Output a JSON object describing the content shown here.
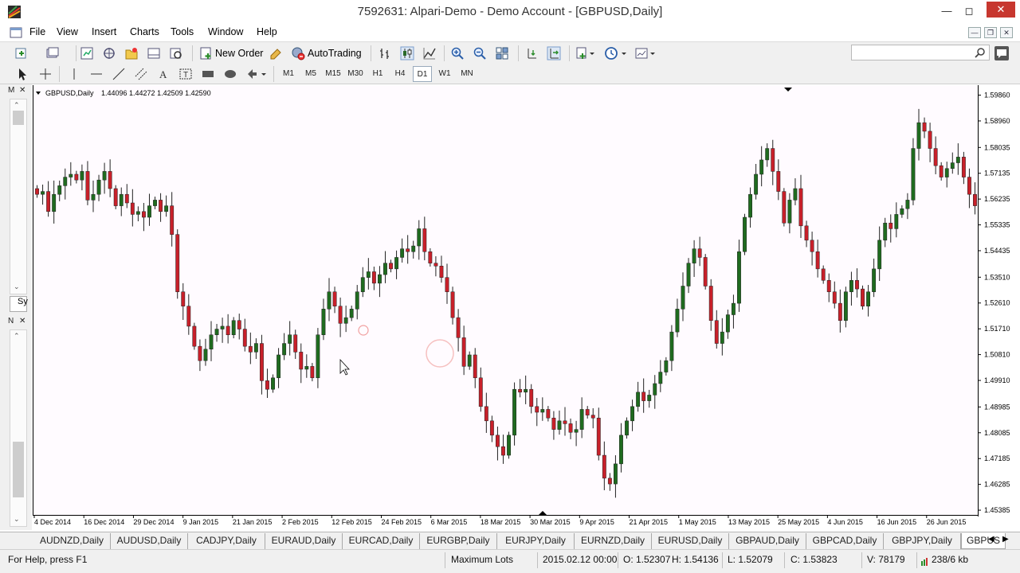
{
  "window": {
    "title": "7592631: Alpari-Demo - Demo Account - [GBPUSD,Daily]"
  },
  "menu": [
    "File",
    "View",
    "Insert",
    "Charts",
    "Tools",
    "Window",
    "Help"
  ],
  "toolbar": {
    "new_order": "New Order",
    "autotrading": "AutoTrading"
  },
  "timeframes": [
    "M1",
    "M5",
    "M15",
    "M30",
    "H1",
    "H4",
    "D1",
    "W1",
    "MN"
  ],
  "active_timeframe": "D1",
  "left_panel": {
    "market_watch_header": "M",
    "market_watch_tab": "Sy",
    "navigator_header": "N"
  },
  "chart_data": {
    "type": "candlestick",
    "title": "GBPUSD,Daily",
    "ohlc_label": "1.44096 1.44272 1.42509 1.42590",
    "y_ticks": [
      "1.59860",
      "1.58960",
      "1.58035",
      "1.57135",
      "1.56235",
      "1.55335",
      "1.54435",
      "1.53510",
      "1.52610",
      "1.51710",
      "1.50810",
      "1.49910",
      "1.48985",
      "1.48085",
      "1.47185",
      "1.46285",
      "1.45385"
    ],
    "ylim": [
      1.4522,
      1.6018
    ],
    "x_ticks": [
      "4 Dec 2014",
      "16 Dec 2014",
      "29 Dec 2014",
      "9 Jan 2015",
      "21 Jan 2015",
      "2 Feb 2015",
      "12 Feb 2015",
      "24 Feb 2015",
      "6 Mar 2015",
      "18 Mar 2015",
      "30 Mar 2015",
      "9 Apr 2015",
      "21 Apr 2015",
      "1 May 2015",
      "13 May 2015",
      "25 May 2015",
      "4 Jun 2015",
      "16 Jun 2015",
      "26 Jun 2015"
    ],
    "close_series": [
      1.564,
      1.565,
      1.558,
      1.564,
      1.567,
      1.57,
      1.571,
      1.569,
      1.572,
      1.562,
      1.564,
      1.569,
      1.572,
      1.566,
      1.56,
      1.564,
      1.561,
      1.557,
      1.558,
      1.556,
      1.56,
      1.562,
      1.558,
      1.56,
      1.55,
      1.53,
      1.525,
      1.518,
      1.511,
      1.506,
      1.51,
      1.515,
      1.517,
      1.518,
      1.515,
      1.52,
      1.517,
      1.511,
      1.509,
      1.512,
      1.499,
      1.496,
      1.5,
      1.508,
      1.512,
      1.515,
      1.509,
      1.503,
      1.504,
      1.5,
      1.515,
      1.524,
      1.53,
      1.525,
      1.519,
      1.521,
      1.524,
      1.53,
      1.535,
      1.537,
      1.533,
      1.536,
      1.54,
      1.538,
      1.542,
      1.545,
      1.544,
      1.546,
      1.552,
      1.544,
      1.54,
      1.539,
      1.535,
      1.53,
      1.521,
      1.514,
      1.504,
      1.508,
      1.5,
      1.49,
      1.485,
      1.48,
      1.476,
      1.473,
      1.48,
      1.496,
      1.495,
      1.496,
      1.49,
      1.488,
      1.489,
      1.486,
      1.482,
      1.485,
      1.484,
      1.481,
      1.482,
      1.489,
      1.487,
      1.486,
      1.473,
      1.465,
      1.463,
      1.47,
      1.48,
      1.485,
      1.49,
      1.495,
      1.492,
      1.494,
      1.498,
      1.502,
      1.506,
      1.516,
      1.524,
      1.532,
      1.54,
      1.545,
      1.542,
      1.532,
      1.52,
      1.512,
      1.516,
      1.522,
      1.526,
      1.544,
      1.556,
      1.564,
      1.571,
      1.576,
      1.58,
      1.572,
      1.565,
      1.554,
      1.562,
      1.566,
      1.553,
      1.548,
      1.544,
      1.538,
      1.534,
      1.53,
      1.526,
      1.52,
      1.53,
      1.534,
      1.531,
      1.525,
      1.53,
      1.538,
      1.548,
      1.554,
      1.552,
      1.557,
      1.559,
      1.562,
      1.58,
      1.589,
      1.586,
      1.58,
      1.574,
      1.57,
      1.573,
      1.575,
      1.577,
      1.57,
      1.564,
      1.56
    ]
  },
  "symbol_tabs": [
    "AUDNZD,Daily",
    "AUDUSD,Daily",
    "CADJPY,Daily",
    "EURAUD,Daily",
    "EURCAD,Daily",
    "EURGBP,Daily",
    "EURJPY,Daily",
    "EURNZD,Daily",
    "EURUSD,Daily",
    "GBPAUD,Daily",
    "GBPCAD,Daily",
    "GBPJPY,Daily",
    "GBPUS"
  ],
  "status": {
    "help": "For Help, press F1",
    "profile": "Maximum Lots",
    "datetime": "2015.02.12 00:00",
    "open": "O: 1.52307",
    "high": "H: 1.54136",
    "low": "L: 1.52079",
    "close": "C: 1.53823",
    "volume": "V: 78179",
    "traffic": "238/6 kb"
  },
  "colors": {
    "bull": "#1f6b1f",
    "bear": "#c8202a",
    "wick": "#222222",
    "grid_bg": "#fffbff"
  }
}
